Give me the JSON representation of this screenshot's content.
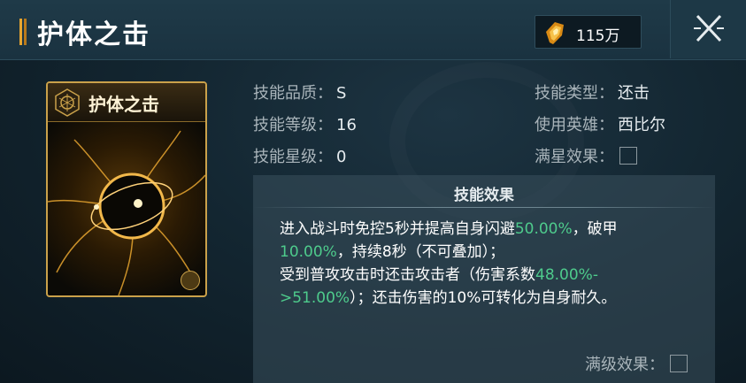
{
  "header": {
    "title": "护体之击",
    "currency_value": "115万",
    "currency_icon": "gold-crystal-icon",
    "close_icon": "close-icon"
  },
  "card": {
    "title": "护体之击",
    "badge_icon": "hexagon-emblem-icon",
    "type_icon": "fist-icon"
  },
  "info": {
    "quality_label": "技能品质：",
    "quality_value": "S",
    "level_label": "技能等级：",
    "level_value": "16",
    "star_label": "技能星级：",
    "star_value": "0",
    "type_label": "技能类型：",
    "type_value": "还击",
    "hero_label": "使用英雄：",
    "hero_value": "西比尔",
    "fullstar_label": "满星效果："
  },
  "effect": {
    "title": "技能效果",
    "l1a": "进入战斗时免控5秒并提高自身闪避",
    "l1b": "50.00%",
    "l1c": "，破甲",
    "l2a": "10.00%",
    "l2b": "，持续8秒（不可叠加）；",
    "l3a": "受到普攻攻击时还击攻击者（伤害系数",
    "l3b": "48.00%-",
    "l4a": ">51.00%",
    "l4b": "）；还击伤害的10%可转化为自身耐久。",
    "maxlevel_label": "满级效果："
  },
  "colors": {
    "accent_gold": "#e8a630",
    "highlight_green": "#4ecb8c"
  }
}
